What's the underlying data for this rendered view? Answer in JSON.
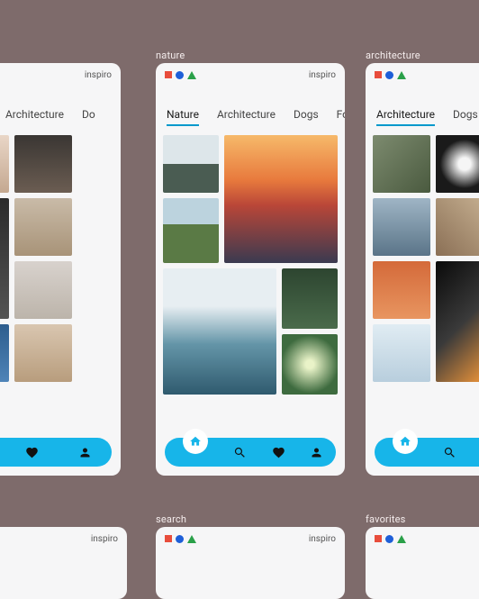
{
  "brand": "inspiro",
  "tabs": [
    "Nature",
    "Architecture",
    "Dogs",
    "Food"
  ],
  "labels": {
    "nature": "nature",
    "architecture": "architecture",
    "search": "search",
    "favorites": "favorites"
  },
  "tabs_short": {
    "dogs_cut": "Do"
  },
  "icons": {
    "search": "search-icon",
    "heart": "heart-icon",
    "person": "person-icon",
    "home": "home-icon"
  }
}
